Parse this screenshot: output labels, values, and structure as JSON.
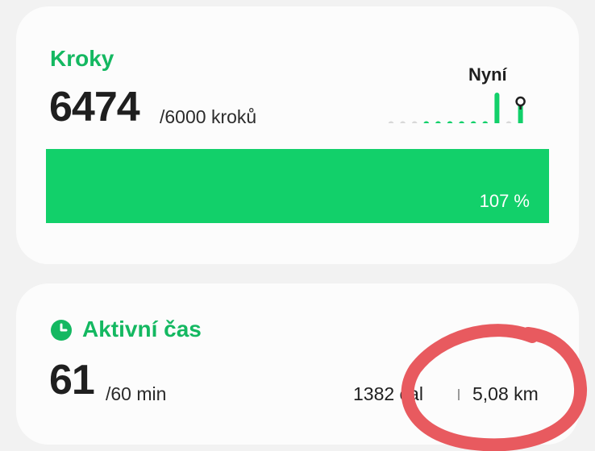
{
  "steps": {
    "title": "Kroky",
    "value": "6474",
    "goal": "/6000 kroků",
    "progress_fraction": 1.0,
    "progress_label": "107 %",
    "now_label": "Nyní",
    "hourly_bars": [
      0,
      0,
      0,
      1,
      1,
      1,
      1,
      1,
      1,
      3,
      0,
      2,
      0,
      0
    ]
  },
  "active_time": {
    "title": "Aktivní čas",
    "value": "61",
    "goal": "/60 min",
    "calories": "1382 cal",
    "distance": "5,08 km"
  },
  "colors": {
    "accent": "#12d06a",
    "title_green": "#14b861",
    "annotation": "#e85a5f"
  },
  "icons": {
    "active_time": "clock-icon",
    "now_marker": "map-pin-icon"
  }
}
